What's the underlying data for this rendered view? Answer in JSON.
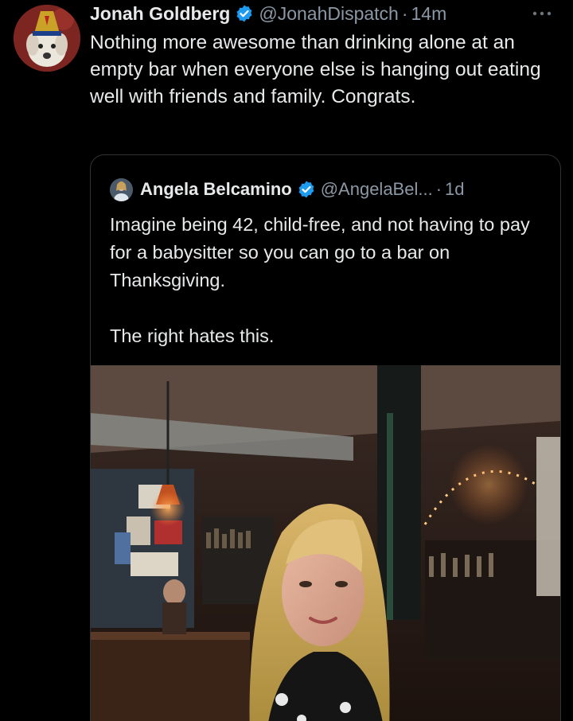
{
  "tweet": {
    "author": {
      "display_name": "Jonah Goldberg",
      "handle": "@JonahDispatch",
      "verified": true,
      "avatar_icon": "dog-avatar"
    },
    "separator": "·",
    "time": "14m",
    "more_icon": "ellipsis-icon",
    "text": "Nothing more awesome than drinking alone at an empty bar when everyone else is hanging out eating well with friends and family. Congrats."
  },
  "quoted_tweet": {
    "author": {
      "display_name": "Angela Belcamino",
      "handle": "@AngelaBel...",
      "verified": true
    },
    "separator": "·",
    "time": "1d",
    "paragraphs": [
      "Imagine being 42, child-free, and not having to pay for a babysitter so you can go to a bar on Thanksgiving.",
      "The right hates this."
    ],
    "media_description": "selfie-in-bar"
  },
  "colors": {
    "background": "#000000",
    "text_primary": "#e7e9ea",
    "text_secondary": "#8b98a5",
    "verified_blue": "#1d9bf0",
    "border": "#2f3336"
  }
}
